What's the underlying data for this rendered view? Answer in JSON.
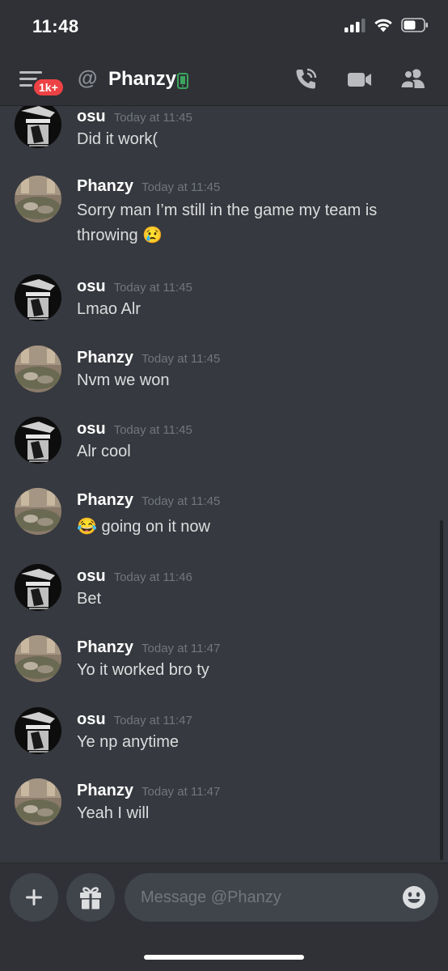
{
  "status_bar": {
    "time": "11:48"
  },
  "header": {
    "badge": "1k+",
    "at_symbol": "@",
    "title": "Phanzy",
    "icons": [
      "menu-icon",
      "call-icon",
      "video-icon",
      "members-icon"
    ]
  },
  "messages": [
    {
      "author": "osu",
      "time": "Today at 11:45",
      "text": "Did it work("
    },
    {
      "author": "Phanzy",
      "time": "Today at 11:45",
      "text": "Sorry man I’m still in the game my team is throwing 😢"
    },
    {
      "author": "osu",
      "time": "Today at 11:45",
      "text": "Lmao Alr"
    },
    {
      "author": "Phanzy",
      "time": "Today at 11:45",
      "text": "Nvm we won"
    },
    {
      "author": "osu",
      "time": "Today at 11:45",
      "text": "Alr cool"
    },
    {
      "author": "Phanzy",
      "time": "Today at 11:45",
      "text": "😂 going on it now"
    },
    {
      "author": "osu",
      "time": "Today at 11:46",
      "text": "Bet"
    },
    {
      "author": "Phanzy",
      "time": "Today at 11:47",
      "text": "Yo it worked bro ty"
    },
    {
      "author": "osu",
      "time": "Today at 11:47",
      "text": "Ye np anytime"
    },
    {
      "author": "Phanzy",
      "time": "Today at 11:47",
      "text": "Yeah I will"
    }
  ],
  "composer": {
    "placeholder": "Message @Phanzy"
  },
  "colors": {
    "background": "#36393f",
    "header": "#2f3136",
    "badge": "#ed4245",
    "online_mobile": "#3ba55d"
  }
}
